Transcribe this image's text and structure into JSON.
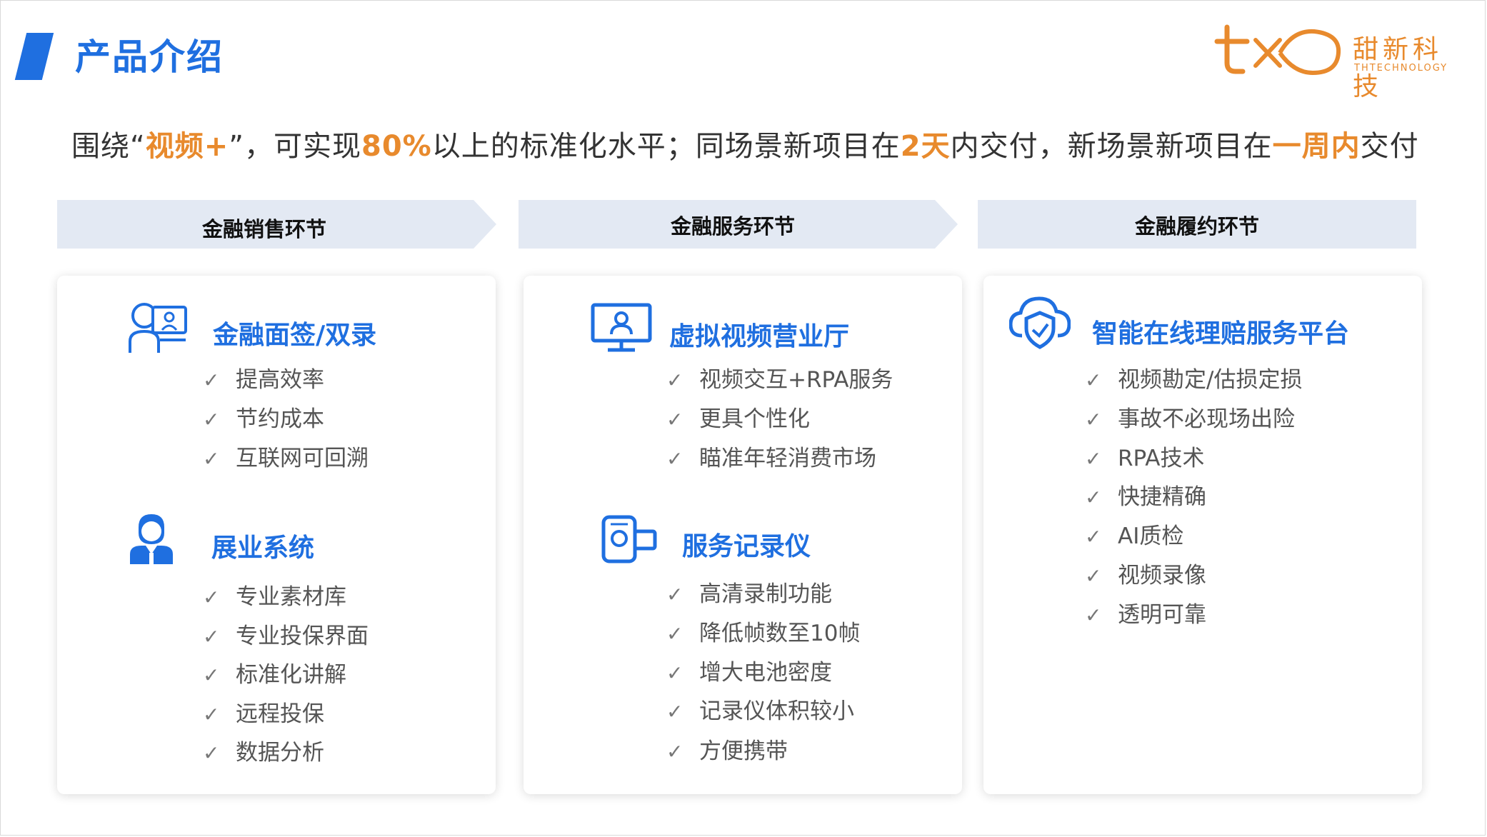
{
  "header": {
    "title": "产品介绍",
    "logo_cn": "甜新科技",
    "logo_en": "THTECHNOLOGY"
  },
  "headline": {
    "p1": "围绕“",
    "h1": "视频+",
    "p2": "”，可实现",
    "h2": "80%",
    "p3": "以上的标准化水平；同场景新项目在",
    "h3": "2天",
    "p4": "内交付，新场景新项目在",
    "h4": "一周内",
    "p5": "交付"
  },
  "stages": [
    "金融销售环节",
    "金融服务环节",
    "金融履约环节"
  ],
  "check_mark": "✓",
  "cards": [
    {
      "sections": [
        {
          "title": "金融面签/双录",
          "icon": "user-video-icon",
          "items": [
            "提高效率",
            "节约成本",
            "互联网可回溯"
          ]
        },
        {
          "title": "展业系统",
          "icon": "agent-person-icon",
          "items": [
            "专业素材库",
            "专业投保界面",
            "标准化讲解",
            "远程投保",
            "数据分析"
          ]
        }
      ]
    },
    {
      "sections": [
        {
          "title": "虚拟视频营业厅",
          "icon": "monitor-person-icon",
          "items": [
            "视频交互+RPA服务",
            "更具个性化",
            "瞄准年轻消费市场"
          ]
        },
        {
          "title": "服务记录仪",
          "icon": "video-camera-icon",
          "items": [
            "高清录制功能",
            "降低帧数至10帧",
            "增大电池密度",
            "记录仪体积较小",
            "方便携带"
          ]
        }
      ]
    },
    {
      "sections": [
        {
          "title": "智能在线理赔服务平台",
          "icon": "cloud-shield-icon",
          "items": [
            "视频勘定/估损定损",
            "事故不必现场出险",
            "RPA技术",
            "快捷精确",
            "AI质检",
            "视频录像",
            "透明可靠"
          ]
        }
      ]
    }
  ],
  "colors": {
    "accent_blue": "#1f6fe0",
    "accent_orange": "#e88a2d",
    "stage_bg": "#e3e9f3"
  }
}
